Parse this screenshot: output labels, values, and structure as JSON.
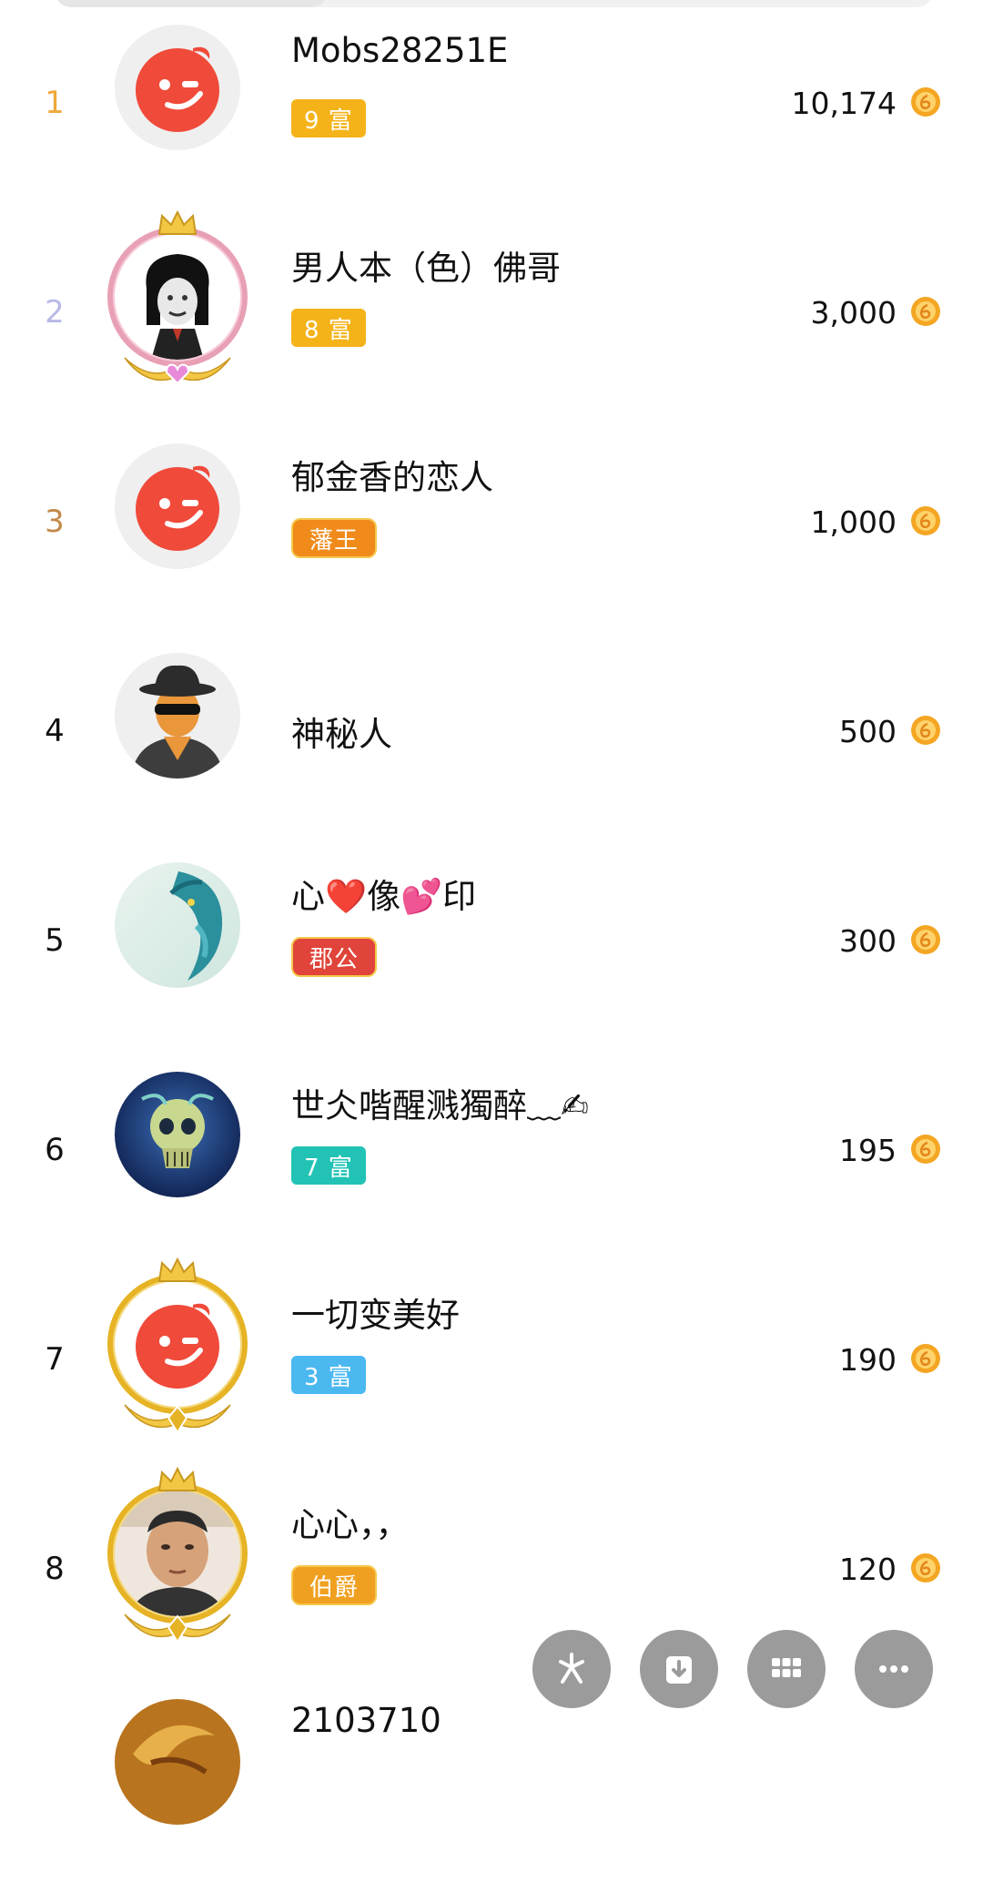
{
  "colors": {
    "gold_rank": "#f0a83a",
    "silver_rank": "#b8b9e6",
    "bronze_rank": "#c48a4a",
    "normal_rank": "#111111",
    "coin": "#f4a623",
    "fab": "#9b9b9b"
  },
  "rows": [
    {
      "rank": "1",
      "name": "Mobs28251E",
      "badge": "9 富",
      "badge_color": "#f5b31a",
      "score": "10,174",
      "avatar": "weibo-logo-avatar",
      "icon": "coin-icon"
    },
    {
      "rank": "2",
      "name": "男人本（色）佛哥",
      "badge": "8 富",
      "badge_color": "#f5b31a",
      "score": "3,000",
      "avatar": "meme-face-avatar",
      "icon": "coin-icon"
    },
    {
      "rank": "3",
      "name": "郁金香的恋人",
      "badge": "藩王",
      "badge_color": "#f08a1a",
      "score": "1,000",
      "avatar": "weibo-logo-avatar",
      "icon": "coin-icon"
    },
    {
      "rank": "4",
      "name": "神秘人",
      "badge": "",
      "badge_color": "",
      "score": "500",
      "avatar": "mystery-man-avatar",
      "icon": "coin-icon"
    },
    {
      "rank": "5",
      "name": "心❤️像💕印",
      "badge": "郡公",
      "badge_color": "#e0443a",
      "score": "300",
      "avatar": "dragon-avatar",
      "icon": "coin-icon"
    },
    {
      "rank": "6",
      "name": "世仌喈醒溅獨醉﹏✍",
      "badge": "7 富",
      "badge_color": "#22c3b5",
      "score": "195",
      "avatar": "skull-avatar",
      "icon": "coin-icon"
    },
    {
      "rank": "7",
      "name": "一切变美好",
      "badge": "3 富",
      "badge_color": "#4bb8f0",
      "score": "190",
      "avatar": "weibo-logo-avatar",
      "icon": "coin-icon"
    },
    {
      "rank": "8",
      "name": "心心，，",
      "badge": "伯爵",
      "badge_color": "#f0a020",
      "score": "120",
      "avatar": "man-photo-avatar",
      "icon": "coin-icon"
    },
    {
      "rank": "",
      "name": "2103710",
      "badge": "",
      "badge_color": "",
      "score": "",
      "avatar": "dragon-gold-avatar",
      "icon": "coin-icon"
    }
  ],
  "fab_buttons": [
    {
      "name": "share-button",
      "icon": "sparkle-icon"
    },
    {
      "name": "download-button",
      "icon": "download-icon"
    },
    {
      "name": "grid-button",
      "icon": "grid-icon"
    },
    {
      "name": "more-button",
      "icon": "more-dots-icon"
    }
  ]
}
